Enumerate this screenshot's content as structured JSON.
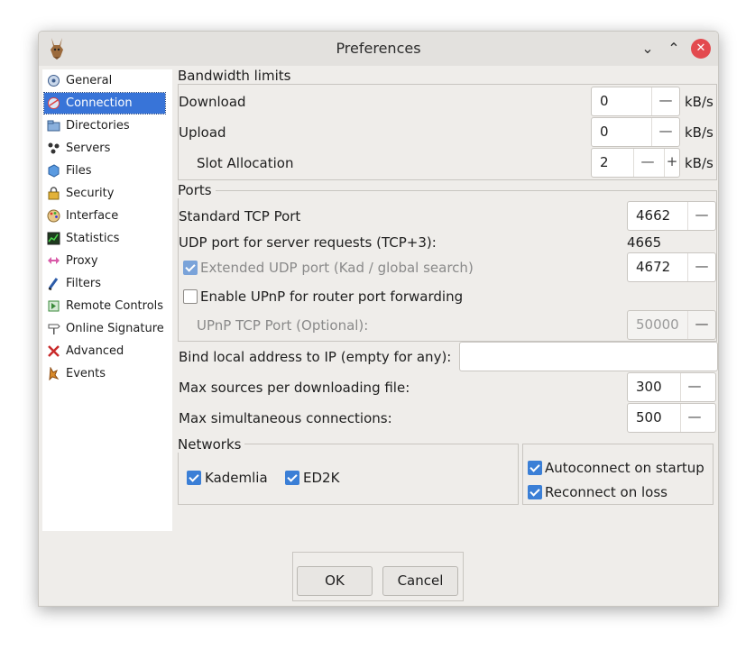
{
  "window": {
    "title": "Preferences"
  },
  "sidebar": {
    "items": [
      {
        "label": "General",
        "icon": "general-icon"
      },
      {
        "label": "Connection",
        "icon": "connection-icon"
      },
      {
        "label": "Directories",
        "icon": "directories-icon"
      },
      {
        "label": "Servers",
        "icon": "servers-icon"
      },
      {
        "label": "Files",
        "icon": "files-icon"
      },
      {
        "label": "Security",
        "icon": "lock-icon"
      },
      {
        "label": "Interface",
        "icon": "palette-icon"
      },
      {
        "label": "Statistics",
        "icon": "statistics-icon"
      },
      {
        "label": "Proxy",
        "icon": "proxy-icon"
      },
      {
        "label": "Filters",
        "icon": "filters-icon"
      },
      {
        "label": "Remote Controls",
        "icon": "remote-controls-icon"
      },
      {
        "label": "Online Signature",
        "icon": "signpost-icon"
      },
      {
        "label": "Advanced",
        "icon": "advanced-icon"
      },
      {
        "label": "Events",
        "icon": "events-icon"
      }
    ],
    "selected": "Connection"
  },
  "bandwidth": {
    "title": "Bandwidth limits",
    "download_label": "Download",
    "download_value": "0",
    "upload_label": "Upload",
    "upload_value": "0",
    "slot_label": "Slot Allocation",
    "slot_value": "2",
    "unit": "kB/s"
  },
  "ports": {
    "title": "Ports",
    "tcp_label": "Standard TCP Port",
    "tcp_value": "4662",
    "udp_server_label": "UDP port for server requests (TCP+3):",
    "udp_server_value": "4665",
    "ext_udp_label": "Extended UDP port (Kad / global search)",
    "ext_udp_value": "4672",
    "upnp_label": "Enable UPnP for router port forwarding",
    "upnp_tcp_label": "UPnP TCP Port (Optional):",
    "upnp_tcp_value": "50000"
  },
  "bind": {
    "label": "Bind local address to IP (empty for any):",
    "value": ""
  },
  "max_sources": {
    "label": "Max sources per downloading file:",
    "value": "300"
  },
  "max_connections": {
    "label": "Max simultaneous connections:",
    "value": "500"
  },
  "networks": {
    "title": "Networks",
    "kademlia": "Kademlia",
    "ed2k": "ED2K"
  },
  "autoconnect": {
    "startup": "Autoconnect on startup",
    "reconnect": "Reconnect on loss"
  },
  "buttons": {
    "ok": "OK",
    "cancel": "Cancel"
  },
  "controls": {
    "minus": "—",
    "plus": "+",
    "minimize": "⌄",
    "maximize": "⌃",
    "close": "✕"
  },
  "colors": {
    "accent": "#3874d8",
    "close": "#e34a4f",
    "checkbox": "#3b7fd6"
  }
}
